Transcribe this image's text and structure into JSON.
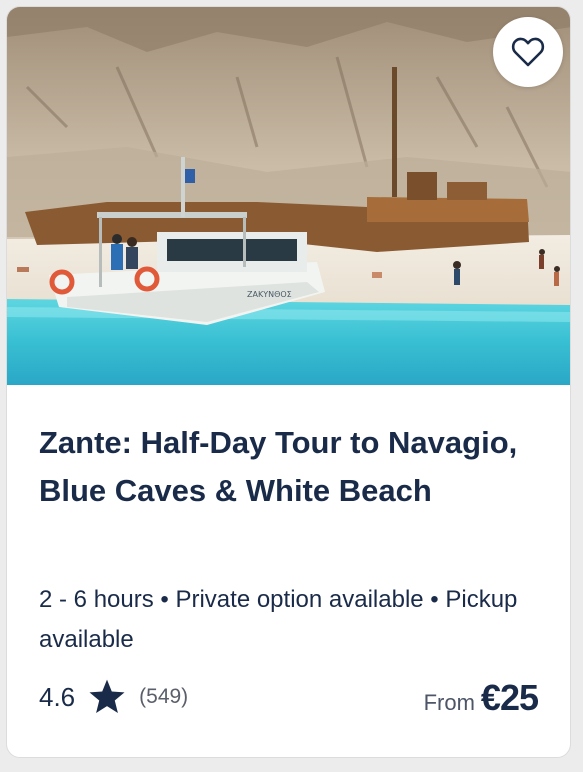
{
  "card": {
    "title": "Zante: Half-Day Tour to Navagio, Blue Caves & White Beach",
    "meta": "2 - 6 hours • Private option available • Pickup available",
    "rating": "4.6",
    "reviews": "(549)",
    "price_prefix": "From",
    "price": "€25",
    "boat_name": "ΖΑΚΥΝΘΟΣ"
  },
  "icons": {
    "wishlist": "heart-outline-icon",
    "rating": "star-icon"
  },
  "colors": {
    "text_primary": "#1a2b49",
    "text_secondary": "#5a5f6b",
    "sea": "#3fc2d6",
    "card_bg": "#ffffff"
  }
}
